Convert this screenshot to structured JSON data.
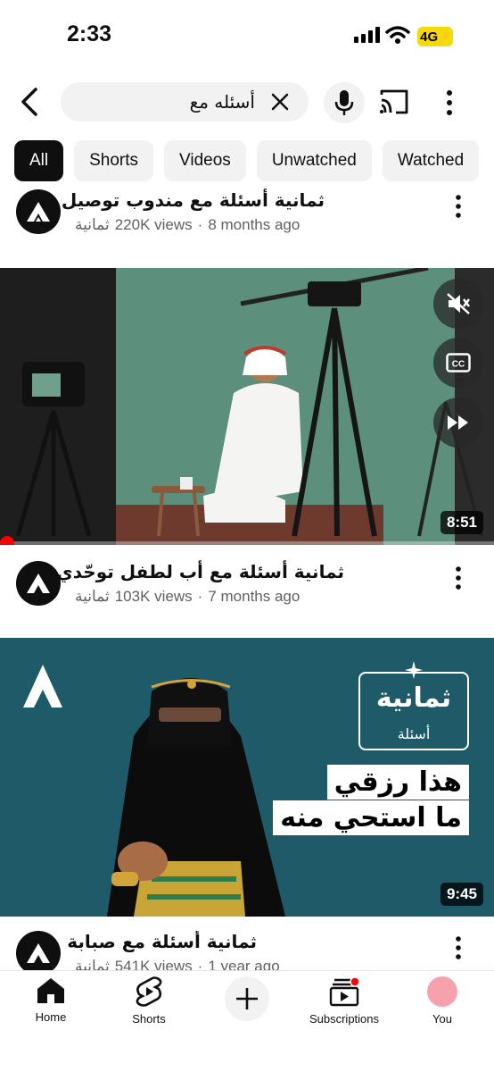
{
  "status_bar": {
    "time": "2:33",
    "network": "4G"
  },
  "search": {
    "query": "أسئله مع"
  },
  "filter_chips": [
    {
      "label": "All",
      "active": true
    },
    {
      "label": "Shorts",
      "active": false
    },
    {
      "label": "Videos",
      "active": false
    },
    {
      "label": "Unwatched",
      "active": false
    },
    {
      "label": "Watched",
      "active": false
    }
  ],
  "videos": [
    {
      "title": "ثمانية أسئلة مع مندوب توصيل",
      "channel": "ثمانية",
      "views": "220K views",
      "age": "8 months ago"
    },
    {
      "title": "ثمانية أسئلة مع أب لطفل توحّدي",
      "channel": "ثمانية",
      "views": "103K views",
      "age": "7 months ago",
      "duration": "8:51"
    },
    {
      "title": "ثمانية أسئلة مع صبابة",
      "channel": "ثمانية",
      "views": "541K views",
      "age": "1 year ago",
      "duration": "9:45"
    }
  ],
  "thumbnail_overlay": {
    "brand": "ثمانية",
    "series": "أسئلة",
    "quote_line1": "هذا رزقي",
    "quote_line2": "ما استحي منه"
  },
  "bottom_nav": [
    {
      "label": "Home",
      "icon": "home-icon",
      "active": true
    },
    {
      "label": "Shorts",
      "icon": "shorts-icon",
      "active": false
    },
    {
      "label": "",
      "icon": "create-icon",
      "active": false
    },
    {
      "label": "Subscriptions",
      "icon": "subscriptions-icon",
      "active": false
    },
    {
      "label": "You",
      "icon": "avatar-icon",
      "active": false
    }
  ],
  "colors": {
    "accent_red": "#ff0000",
    "battery_yellow": "#f5d90a",
    "thumb_teal": "#1f5a68",
    "studio_green": "#5c8f7c"
  }
}
